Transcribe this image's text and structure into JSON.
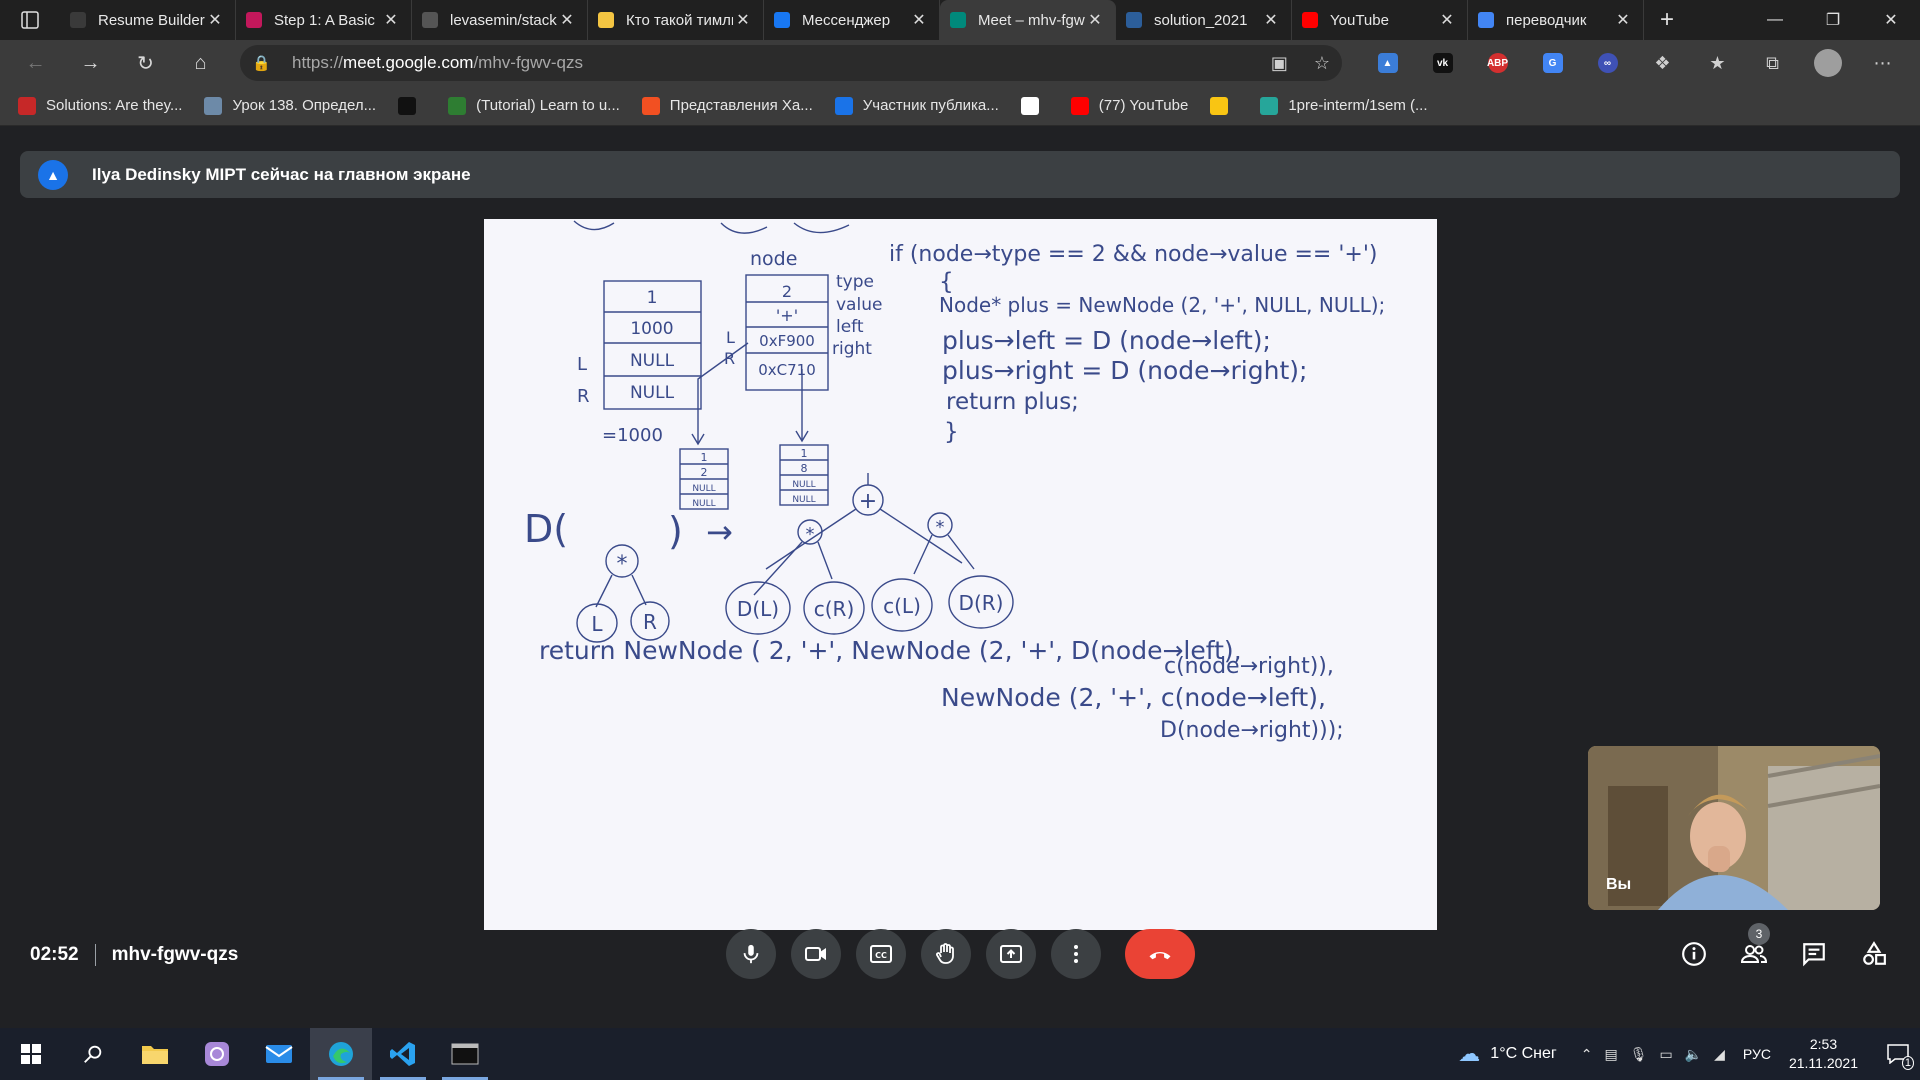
{
  "browser": {
    "tabs": [
      {
        "title": "Resume Builder",
        "favicon": "resume-icon",
        "color": "#3a3a3a",
        "active": false
      },
      {
        "title": "Step 1: A Basic",
        "favicon": "step-icon",
        "color": "#c2185b",
        "active": false
      },
      {
        "title": "levasemin/stack",
        "favicon": "github-icon",
        "color": "#555555",
        "active": false
      },
      {
        "title": "Кто такой тимлид",
        "favicon": "doc-icon",
        "color": "#f4c542",
        "active": false
      },
      {
        "title": "Мессенджер",
        "favicon": "messenger-icon",
        "color": "#1877f2",
        "active": false
      },
      {
        "title": "Meet – mhv-fgwv-qzs",
        "favicon": "meet-icon",
        "color": "#00897b",
        "active": true
      },
      {
        "title": "solution_2021",
        "favicon": "vk-icon",
        "color": "#2c5e9a",
        "active": false
      },
      {
        "title": "YouTube",
        "favicon": "youtube-icon",
        "color": "#ff0000",
        "active": false
      },
      {
        "title": "переводчик",
        "favicon": "google-icon",
        "color": "#4285f4",
        "active": false
      }
    ],
    "url": {
      "prefix": "https://",
      "host": "meet.google.com",
      "path": "/mhv-fgwv-qzs"
    },
    "bookmarks": [
      {
        "label": "Solutions: Are they...",
        "icon": "bookmark-icon-1",
        "color": "#c62828"
      },
      {
        "label": "Урок 138. Определ...",
        "icon": "bookmark-icon-2",
        "color": "#6d8aa8"
      },
      {
        "label": "",
        "icon": "bookmark-icon-3",
        "color": "#111111"
      },
      {
        "label": "(Tutorial) Learn to u...",
        "icon": "bookmark-icon-4",
        "color": "#2e7d32"
      },
      {
        "label": "Представления Ха...",
        "icon": "microsoft-icon",
        "color": "#f25022"
      },
      {
        "label": "Участник публика...",
        "icon": "bookmark-icon-6",
        "color": "#1a73e8"
      },
      {
        "label": "",
        "icon": "wikipedia-icon",
        "color": "#ffffff"
      },
      {
        "label": "(77) YouTube",
        "icon": "youtube-icon",
        "color": "#ff0000"
      },
      {
        "label": "",
        "icon": "emoji-icon",
        "color": "#f9c513"
      },
      {
        "label": "1pre-interm/1sem (...",
        "icon": "bookmark-icon-10",
        "color": "#26a69a"
      }
    ]
  },
  "meet": {
    "banner": "Ilya Dedinsky MIPT сейчас на главном экране",
    "self_label": "Вы",
    "time": "02:52",
    "meeting_code": "mhv-fgwv-qzs",
    "participants_count": "3",
    "end_call_color": "#ea4335"
  },
  "whiteboard": {
    "node_label": "node",
    "left_table": [
      "1",
      "1000",
      "NULL",
      "NULL"
    ],
    "left_row_labels": [
      "L",
      "R"
    ],
    "left_caption": "=1000",
    "node_table": [
      "2",
      "'+'",
      "0xF900",
      "0xC710"
    ],
    "node_fields": [
      "type",
      "value",
      "left",
      "right"
    ],
    "node_row_labels": [
      "L",
      "R"
    ],
    "small_table_1": [
      "1",
      "2",
      "NULL",
      "NULL"
    ],
    "small_table_2": [
      "1",
      "8",
      "NULL",
      "NULL"
    ],
    "code": [
      "if (node→type == 2 && node→value == '+')",
      "{",
      "Node* plus = NewNode (2, '+', NULL, NULL);",
      "plus→left = D (node→left);",
      "plus→right = D (node→right);",
      "return plus;",
      "}"
    ],
    "rule_left": "D(",
    "rule_close": ")",
    "arrow": "→",
    "tree_root": "+",
    "tree_nodes": [
      "*",
      "*"
    ],
    "tree_leaves": [
      "D(L)",
      "c(R)",
      "c(L)",
      "D(R)"
    ],
    "star_node": "*",
    "star_children": [
      "L",
      "R"
    ],
    "return_lines": [
      "return NewNode ( 2, '+', NewNode (2, '+', D(node→left),",
      "c(node→right)),",
      "NewNode (2, '+', c(node→left),",
      "D(node→right)));"
    ]
  },
  "taskbar": {
    "weather": "1°C Снег",
    "lang": "РУС",
    "time": "2:53",
    "date": "21.11.2021",
    "notifications": "1"
  }
}
